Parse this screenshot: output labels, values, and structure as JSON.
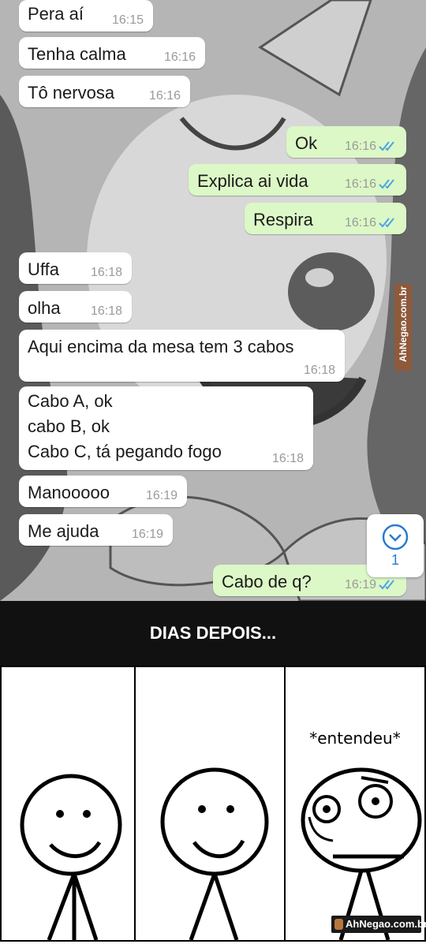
{
  "messages": [
    {
      "dir": "in",
      "text": "Pera aí",
      "time": "16:15"
    },
    {
      "dir": "in",
      "text": "Tenha calma",
      "time": "16:16"
    },
    {
      "dir": "in",
      "text": "Tô nervosa",
      "time": "16:16"
    },
    {
      "dir": "out",
      "text": "Ok",
      "time": "16:16"
    },
    {
      "dir": "out",
      "text": "Explica ai vida",
      "time": "16:16"
    },
    {
      "dir": "out",
      "text": "Respira",
      "time": "16:16"
    },
    {
      "dir": "in",
      "text": "Uffa",
      "time": "16:18"
    },
    {
      "dir": "in",
      "text": "olha",
      "time": "16:18"
    },
    {
      "dir": "in",
      "text": "Aqui encima da mesa tem 3 cabos",
      "time": "16:18"
    },
    {
      "dir": "in",
      "text": "Cabo A, ok\ncabo B, ok\nCabo C, tá pegando fogo",
      "time": "16:18"
    },
    {
      "dir": "in",
      "text": "Manooooo",
      "time": "16:19"
    },
    {
      "dir": "in",
      "text": "Me ajuda",
      "time": "16:19"
    },
    {
      "dir": "out",
      "text": "Cabo de q?",
      "time": "16:19"
    }
  ],
  "scroll_down": {
    "unread_count": "1",
    "icon": "chevron-down-icon"
  },
  "banner": {
    "title": "DIAS DEPOIS..."
  },
  "comic": {
    "panel3_caption": "*entendeu*"
  },
  "watermarks": {
    "side": "AhNegao.com.br",
    "bottom": "AhNegao.com.br"
  },
  "colors": {
    "incoming": "#ffffff",
    "outgoing": "#dcf8c6",
    "read_ticks": "#4fa3e0",
    "banner": "#111111"
  }
}
